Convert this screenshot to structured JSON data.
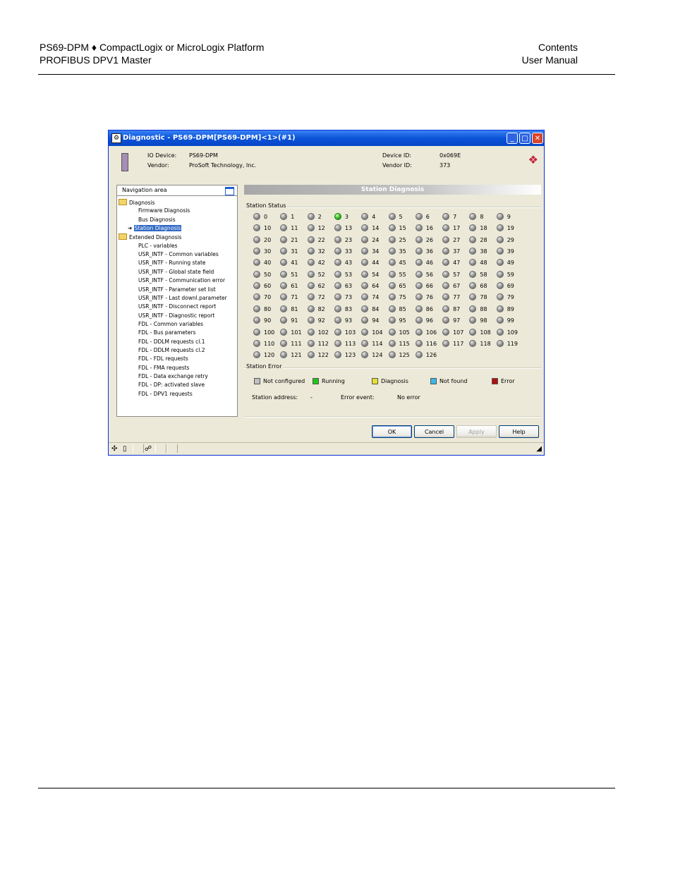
{
  "header": {
    "line1_left": "PS69-DPM ♦ CompactLogix or MicroLogix Platform",
    "line2_left": "PROFIBUS DPV1 Master",
    "line1_right": "Contents",
    "line2_right": "User Manual"
  },
  "window": {
    "title": "Diagnostic - PS69-DPM[PS69-DPM]<1>(#1)",
    "buttons": {
      "minimize": "_",
      "maximize": "□",
      "close": "✕"
    }
  },
  "device": {
    "io_device_label": "IO Device:",
    "io_device_value": "PS69-DPM",
    "vendor_label": "Vendor:",
    "vendor_value": "ProSoft Technology, Inc.",
    "device_id_label": "Device ID:",
    "device_id_value": "0x069E",
    "vendor_id_label": "Vendor ID:",
    "vendor_id_value": "373"
  },
  "nav": {
    "title": "Navigation area",
    "items": [
      {
        "label": "Diagnosis",
        "folder": true,
        "level": 0
      },
      {
        "label": "Firmware Diagnosis",
        "level": 1
      },
      {
        "label": "Bus Diagnosis",
        "level": 1
      },
      {
        "label": "Station Diagnosis",
        "level": 1,
        "selected": true
      },
      {
        "label": "Extended Diagnosis",
        "folder": true,
        "level": 0
      },
      {
        "label": "PLC - variables",
        "level": 1
      },
      {
        "label": "USR_INTF - Common variables",
        "level": 1
      },
      {
        "label": "USR_INTF - Running state",
        "level": 1
      },
      {
        "label": "USR_INTF - Global state field",
        "level": 1
      },
      {
        "label": "USR_INTF - Communication error",
        "level": 1
      },
      {
        "label": "USR_INTF - Parameter set list",
        "level": 1
      },
      {
        "label": "USR_INTF - Last downl.parameter",
        "level": 1
      },
      {
        "label": "USR_INTF - Disconnect report",
        "level": 1
      },
      {
        "label": "USR_INTF - Diagnostic report",
        "level": 1
      },
      {
        "label": "FDL - Common variables",
        "level": 1
      },
      {
        "label": "FDL - Bus parameters",
        "level": 1
      },
      {
        "label": "FDL - DDLM requests cl.1",
        "level": 1
      },
      {
        "label": "FDL - DDLM requests cl.2",
        "level": 1
      },
      {
        "label": "FDL - FDL requests",
        "level": 1
      },
      {
        "label": "FDL - FMA requests",
        "level": 1
      },
      {
        "label": "FDL - Data exchange retry",
        "level": 1
      },
      {
        "label": "FDL - DP: activated slave",
        "level": 1
      },
      {
        "label": "FDL - DPV1 requests",
        "level": 1
      }
    ]
  },
  "station_diagnosis": {
    "title": "Station Diagnosis",
    "status_group_label": "Station Status",
    "station_count": 127,
    "running_stations": [
      3
    ],
    "error_group_label": "Station Error",
    "legend": [
      {
        "label": "Not configured",
        "color": "#c0c0c0"
      },
      {
        "label": "Running",
        "color": "#22c41d"
      },
      {
        "label": "Diagnosis",
        "color": "#e8e030"
      },
      {
        "label": "Not found",
        "color": "#3cb8e8"
      },
      {
        "label": "Error",
        "color": "#b01010"
      }
    ],
    "station_address_label": "Station address:",
    "station_address_value": "-",
    "error_event_label": "Error event:",
    "error_event_value": "No error"
  },
  "buttons": {
    "ok": "OK",
    "cancel": "Cancel",
    "apply": "Apply",
    "help": "Help"
  }
}
